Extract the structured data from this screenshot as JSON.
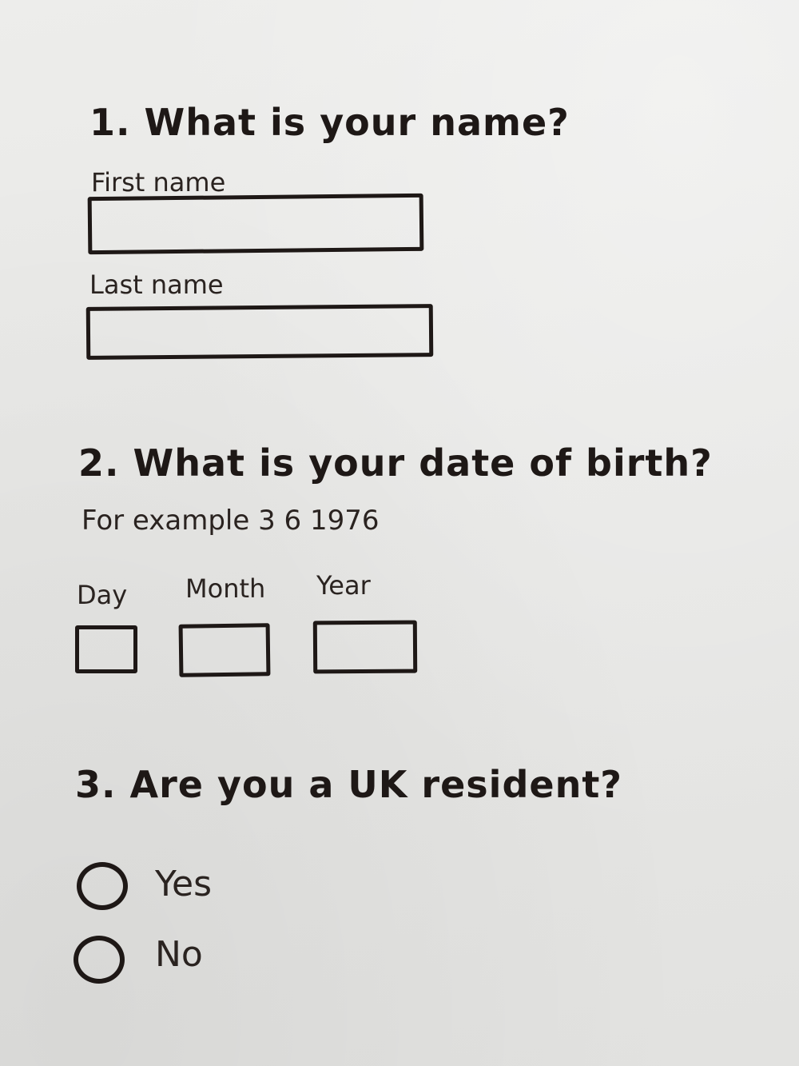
{
  "form": {
    "q1": {
      "question": "1. What is your name?",
      "first_label": "First name",
      "last_label": "Last name"
    },
    "q2": {
      "question": "2. What is your date of birth?",
      "hint": "For example  3  6  1976",
      "day_label": "Day",
      "month_label": "Month",
      "year_label": "Year"
    },
    "q3": {
      "question": "3. Are you a UK resident?",
      "options": [
        "Yes",
        "No"
      ]
    }
  },
  "colors": {
    "ink": "#1e1816",
    "paper": "#e8e8e6"
  }
}
